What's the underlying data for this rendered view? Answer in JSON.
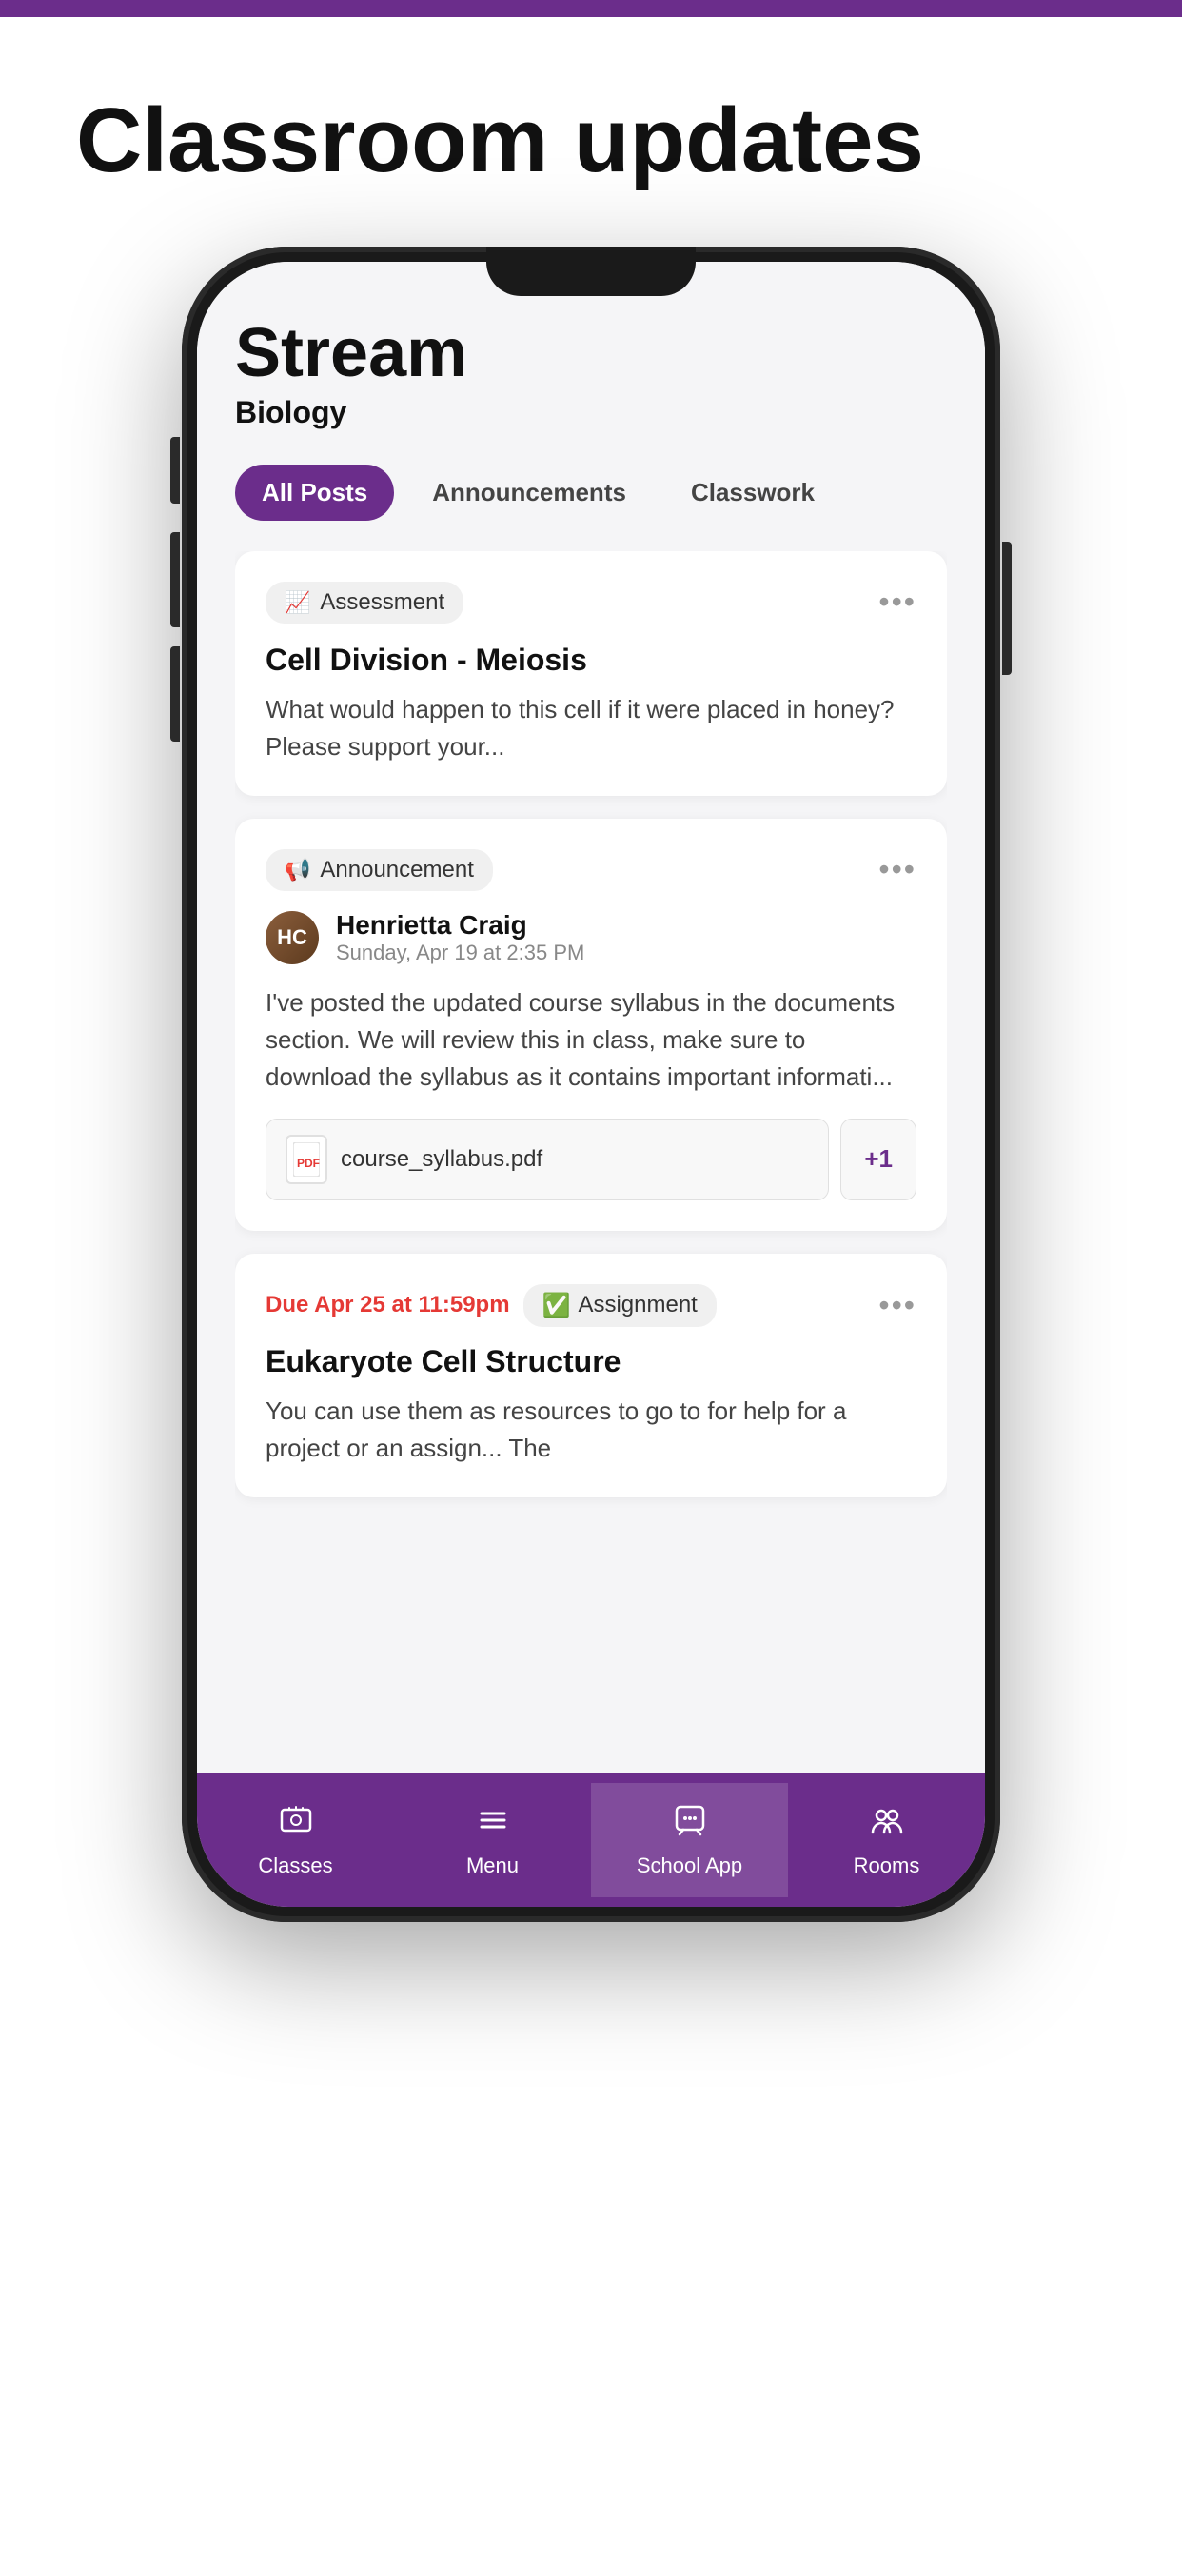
{
  "page": {
    "top_bar_color": "#6B2D8B",
    "title": "Classroom updates",
    "bg_color": "#ffffff"
  },
  "phone": {
    "screen": {
      "stream_title": "Stream",
      "stream_subtitle": "Biology",
      "tabs": [
        {
          "label": "All Posts",
          "active": true
        },
        {
          "label": "Announcements",
          "active": false
        },
        {
          "label": "Classwork",
          "active": false
        }
      ],
      "posts": [
        {
          "type": "assessment",
          "tag": "Assessment",
          "tag_icon": "📈",
          "title": "Cell Division - Meiosis",
          "body": "What would happen to this cell if it were placed in honey? Please support your..."
        },
        {
          "type": "announcement",
          "tag": "Announcement",
          "tag_icon": "📢",
          "author_name": "Henrietta Craig",
          "author_date": "Sunday, Apr 19 at 2:35 PM",
          "body": "I've posted the updated course syllabus in the documents section. We will review this in class, make sure to download the syllabus as it contains important informati...",
          "attachment_name": "course_syllabus.pdf",
          "attachment_more": "+1"
        },
        {
          "type": "assignment",
          "due_date": "Due Apr 25 at 11:59pm",
          "tag": "Assignment",
          "tag_icon": "✅",
          "title": "Eukaryote Cell Structure",
          "body": "You can use them as resources to go to for help for a project or an assign... The"
        }
      ]
    },
    "bottom_nav": [
      {
        "label": "Classes",
        "icon": "🎓",
        "active": false
      },
      {
        "label": "Menu",
        "icon": "☰",
        "active": false
      },
      {
        "label": "School App",
        "icon": "💬",
        "active": true
      },
      {
        "label": "Rooms",
        "icon": "👥",
        "active": false
      }
    ]
  }
}
